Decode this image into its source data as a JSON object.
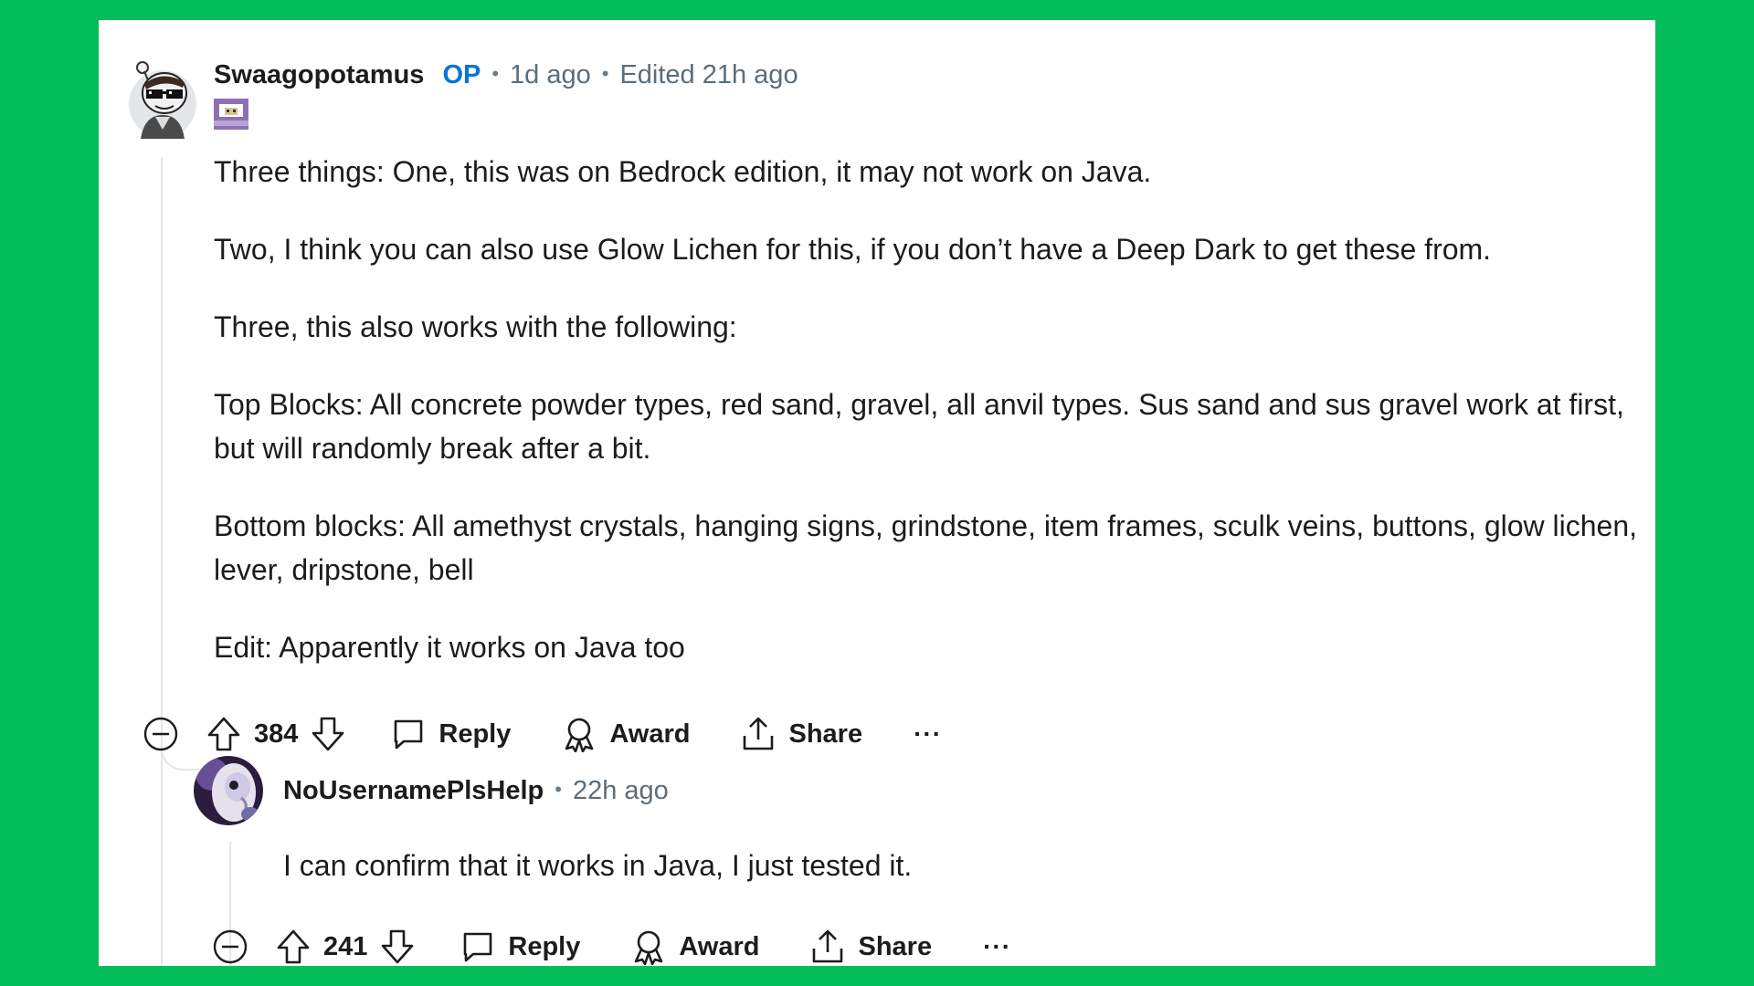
{
  "op_comment": {
    "author": "Swaagopotamus",
    "op_badge": "OP",
    "time": "1d ago",
    "edited": "Edited 21h ago",
    "body": [
      "Three things: One, this was on Bedrock edition, it may not work on Java.",
      "Two, I think you can also use Glow Lichen for this, if you don’t have a Deep Dark to get these from.",
      "Three, this also works with the following:",
      "Top Blocks: All concrete powder types, red sand, gravel, all anvil types. Sus sand and sus gravel work at first, but will randomly break after a bit.",
      "Bottom blocks: All amethyst crystals, hanging signs, grindstone, item frames, sculk veins, buttons, glow lichen, lever, dripstone, bell",
      "Edit: Apparently it works on Java too"
    ],
    "votes": "384",
    "reply_label": "Reply",
    "award_label": "Award",
    "share_label": "Share",
    "more_label": "···"
  },
  "reply_comment": {
    "author": "NoUsernamePlsHelp",
    "time": "22h ago",
    "body": "I can confirm that it works in Java, I just tested it.",
    "votes": "241",
    "reply_label": "Reply",
    "award_label": "Award",
    "share_label": "Share",
    "more_label": "···"
  },
  "colors": {
    "background": "#03bd5b",
    "card": "#ffffff",
    "op_badge": "#0a74d8",
    "meta_text": "#5c6c7a",
    "thread_line": "#e4e6e8"
  },
  "icons": [
    "collapse-icon",
    "upvote-icon",
    "downvote-icon",
    "comment-icon",
    "award-icon",
    "share-icon",
    "more-icon"
  ]
}
